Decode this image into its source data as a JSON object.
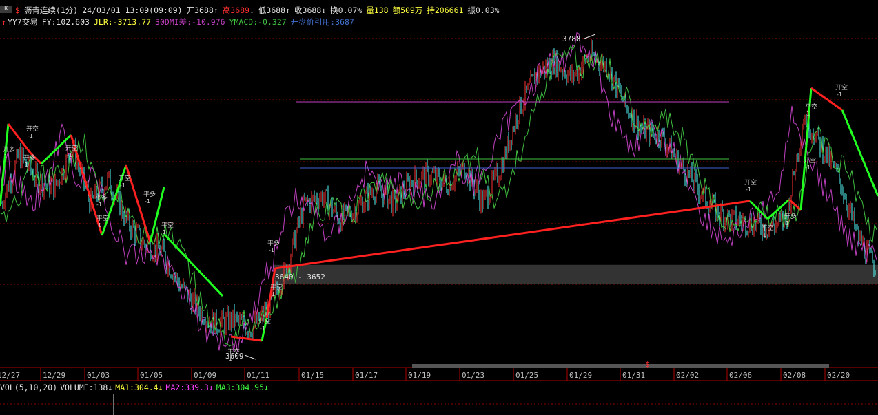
{
  "header": {
    "menu_label": "K",
    "dollar": "$",
    "instrument": "沥青连续(1分)",
    "datetime": "24/03/01 13:09(09:09)",
    "open_label": "开3688",
    "open_arrow": "↑",
    "high_label": "高3689",
    "high_arrow": "↓",
    "low_label": "低3688",
    "low_arrow": "↑",
    "close_label": "收3688",
    "close_arrow": "↓",
    "turnover_label": "换0.07%",
    "volume_label": "量138",
    "amount_label": "额509万",
    "hold_label": "持206661",
    "amplitude_label": "振0.03%"
  },
  "indicator_line": {
    "arrow": "↑",
    "name": "YY7交易",
    "fy": "FY:102.603",
    "jlr": "JLR:-3713.77",
    "dmi": "30DMI差:-10.976",
    "ymacd": "YMACD:-0.327",
    "open_ref": "开盘价引用:3687"
  },
  "volume_panel": {
    "label": "VOL(5,10,20)",
    "volume": "VOLUME:138",
    "volume_arrow": "↓",
    "ma1": "MA1:304.4",
    "ma1_arrow": "↓",
    "ma2": "MA2:339.3",
    "ma2_arrow": "↓",
    "ma3": "MA3:304.95",
    "ma3_arrow": "↓"
  },
  "chart_data": {
    "type": "candlestick",
    "instrument": "沥青连续",
    "interval": "1分",
    "ylim": [
      3590,
      3800
    ],
    "x_ticks": [
      "12/27",
      "12/29",
      "01/03",
      "01/05",
      "01/09",
      "01/11",
      "01/15",
      "01/17",
      "01/19",
      "01/23",
      "01/25",
      "01/29",
      "01/31",
      "02/02",
      "02/06",
      "02/08",
      "02/20"
    ],
    "annotations": {
      "high_label": "3788",
      "low_label": "3609",
      "box_label": "3640 - 3652",
      "box_low": 3640,
      "box_high": 3652,
      "marker_dollar": "$"
    },
    "price_path": [
      [
        0,
        3690
      ],
      [
        1,
        3720
      ],
      [
        2,
        3705
      ],
      [
        3,
        3700
      ],
      [
        4,
        3725
      ],
      [
        5,
        3690
      ],
      [
        6,
        3705
      ],
      [
        7,
        3680
      ],
      [
        8,
        3665
      ],
      [
        9,
        3660
      ],
      [
        10,
        3640
      ],
      [
        11,
        3625
      ],
      [
        12,
        3615
      ],
      [
        13,
        3618
      ],
      [
        14,
        3612
      ],
      [
        15,
        3625
      ],
      [
        16,
        3650
      ],
      [
        17,
        3690
      ],
      [
        18,
        3695
      ],
      [
        19,
        3680
      ],
      [
        20,
        3688
      ],
      [
        21,
        3700
      ],
      [
        22,
        3690
      ],
      [
        23,
        3704
      ],
      [
        24,
        3708
      ],
      [
        25,
        3702
      ],
      [
        26,
        3712
      ],
      [
        27,
        3690
      ],
      [
        28,
        3712
      ],
      [
        29,
        3748
      ],
      [
        30,
        3770
      ],
      [
        31,
        3778
      ],
      [
        32,
        3768
      ],
      [
        33,
        3782
      ],
      [
        34,
        3775
      ],
      [
        35,
        3750
      ],
      [
        36,
        3735
      ],
      [
        37,
        3732
      ],
      [
        38,
        3715
      ],
      [
        39,
        3700
      ],
      [
        40,
        3686
      ],
      [
        41,
        3680
      ],
      [
        42,
        3678
      ],
      [
        43,
        3675
      ],
      [
        44,
        3680
      ],
      [
        45,
        3745
      ],
      [
        46,
        3725
      ],
      [
        47,
        3705
      ],
      [
        48,
        3670
      ],
      [
        49,
        3650
      ]
    ],
    "signals": [
      {
        "label": "开多",
        "sub": "1"
      },
      {
        "label": "开空",
        "sub": "-1"
      },
      {
        "label": "平多",
        "sub": "-1"
      },
      {
        "label": "平空",
        "sub": "1"
      }
    ],
    "indicator_series": [
      {
        "name": "30DMI差",
        "color": "#c040c0"
      },
      {
        "name": "YMACD",
        "color": "#40c040"
      }
    ],
    "volume_series": [
      {
        "name": "MA1",
        "value": 304.4,
        "color": "#ffff00"
      },
      {
        "name": "MA2",
        "value": 339.3,
        "color": "#ff40ff"
      },
      {
        "name": "MA3",
        "value": 304.95,
        "color": "#40ff40"
      }
    ]
  },
  "colors": {
    "up": "#ff3232",
    "down": "#54fcfc",
    "grid_dotted": "#8b0000",
    "axis": "#b00000",
    "signal_up": "#ff2020",
    "signal_down": "#20ff20",
    "purple": "#c040c0",
    "green_line": "#40c040",
    "blue_line": "#4060d0"
  }
}
